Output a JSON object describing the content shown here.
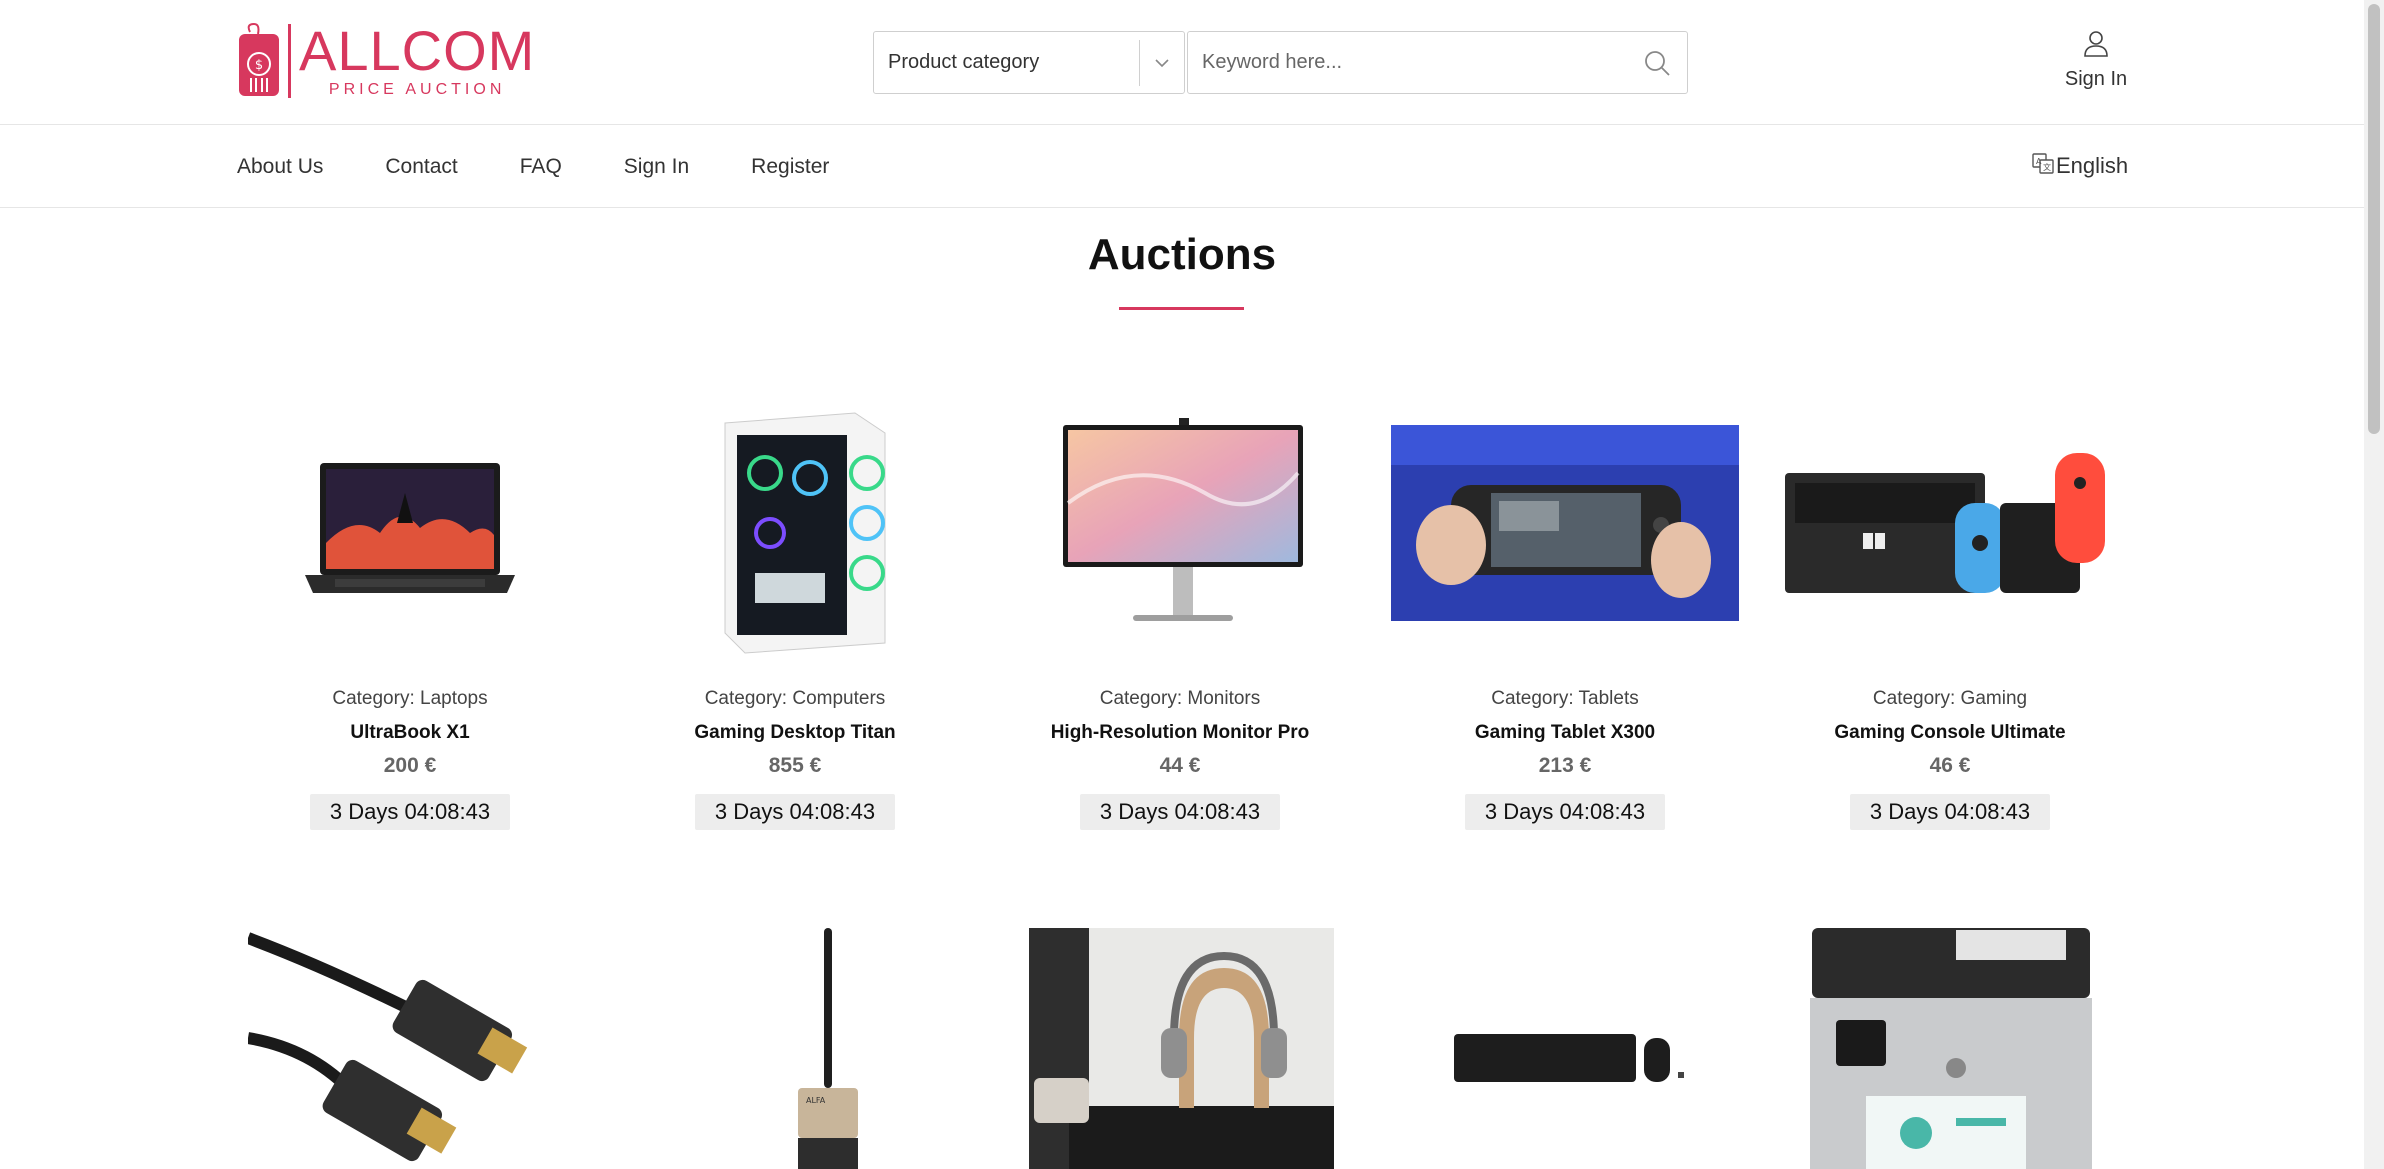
{
  "brand": {
    "title": "ALLCOM",
    "subtitle": "PRICE AUCTION",
    "accent_color": "#d7385e"
  },
  "search": {
    "category_label": "Product category",
    "keyword_placeholder": "Keyword here...",
    "search_icon": "search-icon"
  },
  "header": {
    "signin_label": "Sign In",
    "user_icon": "user-icon"
  },
  "nav": {
    "items": [
      {
        "label": "About Us"
      },
      {
        "label": "Contact"
      },
      {
        "label": "FAQ"
      },
      {
        "label": "Sign In"
      },
      {
        "label": "Register"
      }
    ],
    "language": "English",
    "language_icon": "translate-icon"
  },
  "auctions": {
    "title": "Auctions",
    "items": [
      {
        "category": "Category: Laptops",
        "name": "UltraBook X1",
        "price": "200 €",
        "timer": "3 Days 04:08:43",
        "image": "laptop-image"
      },
      {
        "category": "Category: Computers",
        "name": "Gaming Desktop Titan",
        "price": "855 €",
        "timer": "3 Days 04:08:43",
        "image": "desktop-pc-image"
      },
      {
        "category": "Category: Monitors",
        "name": "High-Resolution Monitor Pro",
        "price": "44 €",
        "timer": "3 Days 04:08:43",
        "image": "monitor-image"
      },
      {
        "category": "Category: Tablets",
        "name": "Gaming Tablet X300",
        "price": "213 €",
        "timer": "3 Days 04:08:43",
        "image": "gaming-tablet-image"
      },
      {
        "category": "Category: Gaming",
        "name": "Gaming Console Ultimate",
        "price": "46 €",
        "timer": "3 Days 04:08:43",
        "image": "game-console-image"
      }
    ],
    "row2_images": [
      "hdmi-cable-image",
      "wifi-adapter-image",
      "headphones-stand-image",
      "keyboard-mouse-image",
      "printer-image"
    ]
  }
}
